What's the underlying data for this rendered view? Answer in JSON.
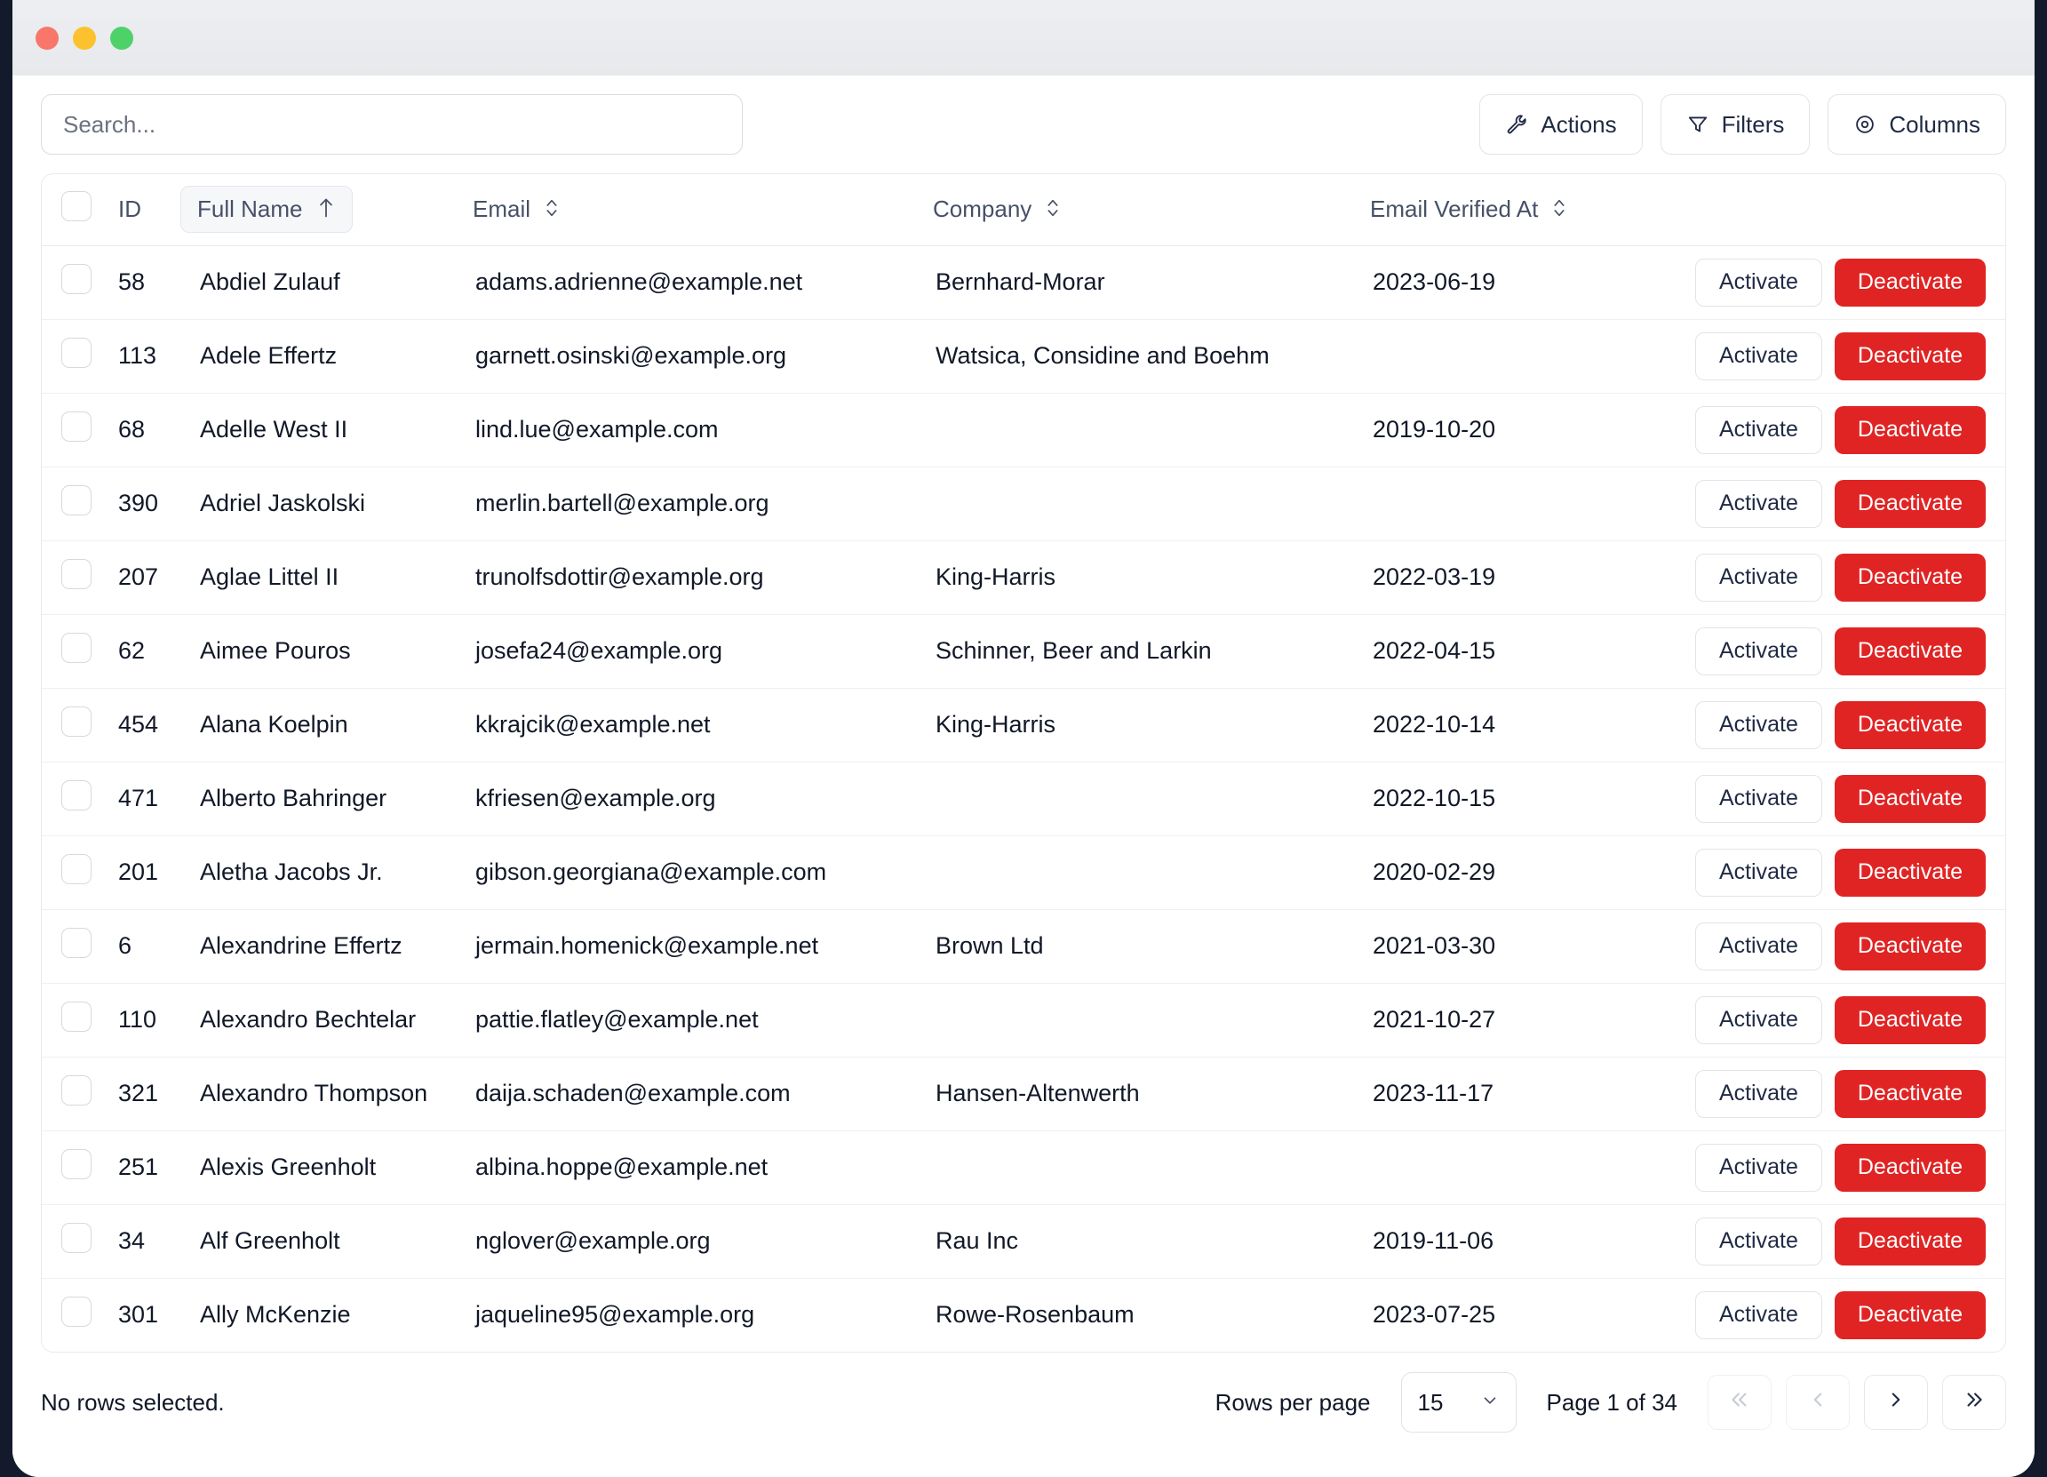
{
  "window": {
    "traffic_lights": [
      "close",
      "minimize",
      "maximize"
    ],
    "colors": {
      "close": "#f9766b",
      "minimize": "#fbc22d",
      "maximize": "#4fd16a",
      "danger": "#e02424",
      "backdrop": "#131a2b"
    }
  },
  "toolbar": {
    "search_placeholder": "Search...",
    "search_value": "",
    "actions_label": "Actions",
    "filters_label": "Filters",
    "columns_label": "Columns"
  },
  "table": {
    "columns": [
      {
        "key": "id",
        "label": "ID",
        "sortable": false,
        "sort": "none"
      },
      {
        "key": "name",
        "label": "Full Name",
        "sortable": true,
        "sort": "asc"
      },
      {
        "key": "email",
        "label": "Email",
        "sortable": true,
        "sort": "none"
      },
      {
        "key": "company",
        "label": "Company",
        "sortable": true,
        "sort": "none"
      },
      {
        "key": "verified",
        "label": "Email Verified At",
        "sortable": true,
        "sort": "none"
      }
    ],
    "sort_asc_glyph": "↑",
    "sort_none_glyph": "⌃⌄",
    "row_actions": {
      "activate": "Activate",
      "deactivate": "Deactivate"
    },
    "rows": [
      {
        "id": "58",
        "name": "Abdiel Zulauf",
        "email": "adams.adrienne@example.net",
        "company": "Bernhard-Morar",
        "verified": "2023-06-19"
      },
      {
        "id": "113",
        "name": "Adele Effertz",
        "email": "garnett.osinski@example.org",
        "company": "Watsica, Considine and Boehm",
        "verified": ""
      },
      {
        "id": "68",
        "name": "Adelle West II",
        "email": "lind.lue@example.com",
        "company": "",
        "verified": "2019-10-20"
      },
      {
        "id": "390",
        "name": "Adriel Jaskolski",
        "email": "merlin.bartell@example.org",
        "company": "",
        "verified": ""
      },
      {
        "id": "207",
        "name": "Aglae Littel II",
        "email": "trunolfsdottir@example.org",
        "company": "King-Harris",
        "verified": "2022-03-19"
      },
      {
        "id": "62",
        "name": "Aimee Pouros",
        "email": "josefa24@example.org",
        "company": "Schinner, Beer and Larkin",
        "verified": "2022-04-15"
      },
      {
        "id": "454",
        "name": "Alana Koelpin",
        "email": "kkrajcik@example.net",
        "company": "King-Harris",
        "verified": "2022-10-14"
      },
      {
        "id": "471",
        "name": "Alberto Bahringer",
        "email": "kfriesen@example.org",
        "company": "",
        "verified": "2022-10-15"
      },
      {
        "id": "201",
        "name": "Aletha Jacobs Jr.",
        "email": "gibson.georgiana@example.com",
        "company": "",
        "verified": "2020-02-29"
      },
      {
        "id": "6",
        "name": "Alexandrine Effertz",
        "email": "jermain.homenick@example.net",
        "company": "Brown Ltd",
        "verified": "2021-03-30"
      },
      {
        "id": "110",
        "name": "Alexandro Bechtelar",
        "email": "pattie.flatley@example.net",
        "company": "",
        "verified": "2021-10-27"
      },
      {
        "id": "321",
        "name": "Alexandro Thompson",
        "email": "daija.schaden@example.com",
        "company": "Hansen-Altenwerth",
        "verified": "2023-11-17"
      },
      {
        "id": "251",
        "name": "Alexis Greenholt",
        "email": "albina.hoppe@example.net",
        "company": "",
        "verified": ""
      },
      {
        "id": "34",
        "name": "Alf Greenholt",
        "email": "nglover@example.org",
        "company": "Rau Inc",
        "verified": "2019-11-06"
      },
      {
        "id": "301",
        "name": "Ally McKenzie",
        "email": "jaqueline95@example.org",
        "company": "Rowe-Rosenbaum",
        "verified": "2023-07-25"
      }
    ]
  },
  "footer": {
    "selection_status": "No rows selected.",
    "rows_per_page_label": "Rows per page",
    "rows_per_page_value": "15",
    "rows_per_page_options": [
      "15"
    ],
    "page_label": "Page 1 of 34",
    "pager": {
      "first": "«",
      "prev": "‹",
      "next": "›",
      "last": "»"
    }
  }
}
